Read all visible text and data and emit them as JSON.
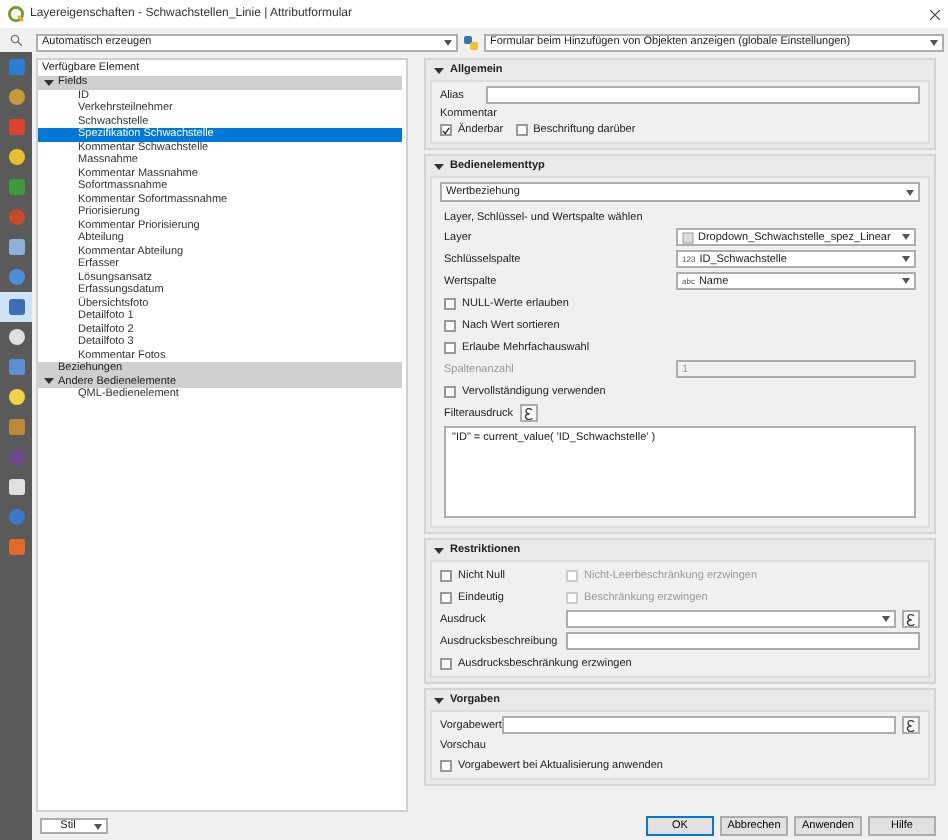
{
  "window": {
    "title": "Layereigenschaften - Schwachstellen_Linie | Attributformular"
  },
  "sidebar": {
    "items": [
      {
        "selected": false
      },
      {
        "selected": false
      },
      {
        "selected": false
      },
      {
        "selected": false
      },
      {
        "selected": false
      },
      {
        "selected": false
      },
      {
        "selected": false
      },
      {
        "selected": false
      },
      {
        "selected": true
      },
      {
        "selected": false
      },
      {
        "selected": false
      },
      {
        "selected": false
      },
      {
        "selected": false
      },
      {
        "selected": false
      },
      {
        "selected": false
      },
      {
        "selected": false
      },
      {
        "selected": false
      }
    ]
  },
  "toolbar": {
    "layout_mode": "Automatisch erzeugen",
    "form_mode": "Formular beim Hinzufügen von Objekten anzeigen (globale Einstellungen)"
  },
  "tree": {
    "header": "Verfügbare Element",
    "items": [
      {
        "label": "Fields",
        "expanded": true,
        "children": [
          {
            "label": "ID",
            "selected": false
          },
          {
            "label": "Verkehrsteilnehmer",
            "selected": false
          },
          {
            "label": "Schwachstelle",
            "selected": false
          },
          {
            "label": "Spezifikation Schwachstelle",
            "selected": true
          },
          {
            "label": "Kommentar Schwachstelle",
            "selected": false
          },
          {
            "label": "Massnahme",
            "selected": false
          },
          {
            "label": "Kommentar Massnahme",
            "selected": false
          },
          {
            "label": "Sofortmassnahme",
            "selected": false
          },
          {
            "label": "Kommentar Sofortmassnahme",
            "selected": false
          },
          {
            "label": "Priorisierung",
            "selected": false
          },
          {
            "label": "Kommentar Priorisierung",
            "selected": false
          },
          {
            "label": "Abteilung",
            "selected": false
          },
          {
            "label": "Kommentar Abteilung",
            "selected": false
          },
          {
            "label": "Erfasser",
            "selected": false
          },
          {
            "label": "Lösungsansatz",
            "selected": false
          },
          {
            "label": "Erfassungsdatum",
            "selected": false
          },
          {
            "label": "Übersichtsfoto",
            "selected": false
          },
          {
            "label": "Detailfoto 1",
            "selected": false
          },
          {
            "label": "Detailfoto 2",
            "selected": false
          },
          {
            "label": "Detailfoto 3",
            "selected": false
          },
          {
            "label": "Kommentar Fotos",
            "selected": false
          }
        ]
      },
      {
        "label": "Beziehungen"
      },
      {
        "label": "Andere Bedienelemente",
        "expanded": true,
        "children": [
          {
            "label": "QML-Bedienelement",
            "selected": false
          }
        ]
      }
    ]
  },
  "general": {
    "title": "Allgemein",
    "expanded": true,
    "alias_label": "Alias",
    "comment_label": "Kommentar",
    "checkboxes": [
      {
        "label": "Änderbar",
        "checked": true
      },
      {
        "label": "Beschriftung darüber",
        "checked": false
      }
    ]
  },
  "widget": {
    "title": "Bedienelementtyp",
    "expanded": true,
    "type": "Wertbeziehung",
    "subtitle": "Layer, Schlüssel- und Wertspalte wählen",
    "fields": [
      {
        "label": "Layer",
        "kind": "layer",
        "value": "Dropdown_Schwachstelle_spez_Linear"
      },
      {
        "label": "Schlüsselspalte",
        "kind": "field",
        "badge": "123",
        "value": "ID_Schwachstelle"
      },
      {
        "label": "Wertspalte",
        "kind": "field",
        "badge": "abc",
        "value": "Name"
      }
    ],
    "options": [
      {
        "label": "NULL-Werte erlauben",
        "checked": false
      },
      {
        "label": "Nach Wert sortieren",
        "checked": false
      },
      {
        "label": "Erlaube Mehrfachauswahl",
        "checked": false
      }
    ],
    "columns": {
      "label": "Spaltenanzahl",
      "value": "1",
      "disabled": true
    },
    "completer": {
      "label": "Vervollständigung verwenden",
      "checked": false
    },
    "filter": {
      "label": "Filterausdruck",
      "expression": "\"ID\" = current_value( 'ID_Schwachstelle' )"
    }
  },
  "constraints": {
    "title": "Restriktionen",
    "expanded": true,
    "rows": [
      {
        "label": "Nicht Null",
        "checked": false,
        "enforce": {
          "label": "Nicht-Leerbeschränkung erzwingen",
          "checked": false,
          "disabled": true
        }
      },
      {
        "label": "Eindeutig",
        "checked": false,
        "enforce": {
          "label": "Beschränkung erzwingen",
          "checked": false,
          "disabled": true
        }
      }
    ],
    "expression_label": "Ausdruck",
    "description_label": "Ausdrucksbeschreibung",
    "enforce": {
      "label": "Ausdrucksbeschränkung erzwingen",
      "checked": false
    }
  },
  "defaults": {
    "title": "Vorgaben",
    "expanded": true,
    "value_label": "Vorgabewert",
    "preview_label": "Vorschau",
    "apply": {
      "label": "Vorgabewert bei Aktualisierung anwenden",
      "checked": false
    }
  },
  "footer": {
    "style": "Stil",
    "buttons": [
      {
        "label": "OK",
        "default": true
      },
      {
        "label": "Abbrechen",
        "default": false
      },
      {
        "label": "Anwenden",
        "default": false
      },
      {
        "label": "Hilfe",
        "default": false
      }
    ]
  }
}
